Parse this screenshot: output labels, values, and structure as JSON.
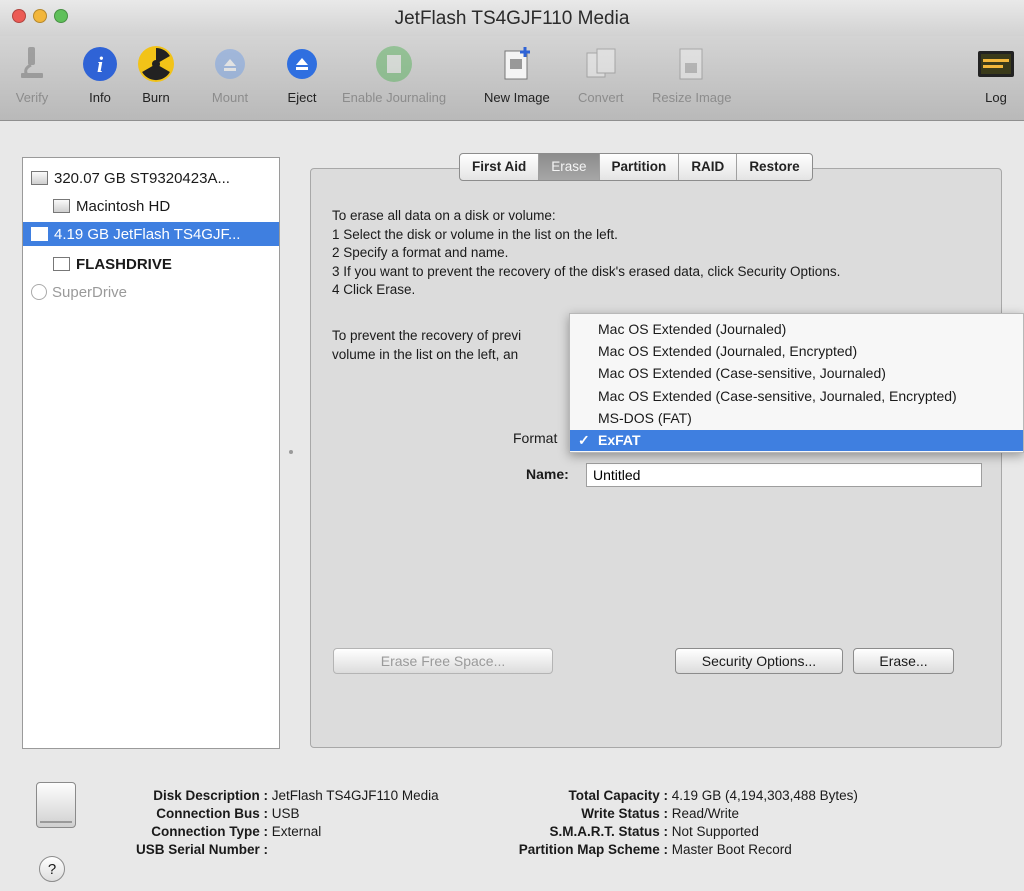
{
  "window": {
    "title": "JetFlash TS4GJF110 Media",
    "traffic_colors": [
      "#ec5b55",
      "#f2b63b",
      "#5fc05a"
    ]
  },
  "toolbar": {
    "items": [
      {
        "label": "Verify",
        "icon": "microscope-icon",
        "enabled": false
      },
      {
        "label": "Info",
        "icon": "info-icon",
        "enabled": true
      },
      {
        "label": "Burn",
        "icon": "radiation-icon",
        "enabled": true
      },
      {
        "label": "Mount",
        "icon": "mount-icon",
        "enabled": false
      },
      {
        "label": "Eject",
        "icon": "eject-icon",
        "enabled": true
      },
      {
        "label": "Enable Journaling",
        "icon": "journal-icon",
        "enabled": false
      },
      {
        "label": "New Image",
        "icon": "new-image-icon",
        "enabled": true
      },
      {
        "label": "Convert",
        "icon": "convert-icon",
        "enabled": false
      },
      {
        "label": "Resize Image",
        "icon": "resize-image-icon",
        "enabled": false
      },
      {
        "label": "Log",
        "icon": "log-icon",
        "enabled": true
      }
    ]
  },
  "sidebar": {
    "items": [
      {
        "label": "320.07 GB ST9320423A...",
        "level": 0,
        "selected": false,
        "dim": false
      },
      {
        "label": "Macintosh HD",
        "level": 1,
        "selected": false,
        "dim": false
      },
      {
        "label": "4.19 GB JetFlash TS4GJF...",
        "level": 0,
        "selected": true,
        "dim": false
      },
      {
        "label": "FLASHDRIVE",
        "level": 1,
        "selected": false,
        "dim": false
      },
      {
        "label": "SuperDrive",
        "level": 0,
        "selected": false,
        "dim": true
      }
    ]
  },
  "tabs": [
    {
      "label": "First Aid",
      "active": false
    },
    {
      "label": "Erase",
      "active": true
    },
    {
      "label": "Partition",
      "active": false
    },
    {
      "label": "RAID",
      "active": false
    },
    {
      "label": "Restore",
      "active": false
    }
  ],
  "erase": {
    "instructions": [
      "To erase all data on a disk or volume:",
      "1 Select the disk or volume in the list on the left.",
      "2 Specify a format and name.",
      "3 If you want to prevent the recovery of the disk's erased data, click Security Options.",
      "4 Click Erase."
    ],
    "prevent_text": [
      "To prevent the recovery of previ",
      "volume in the list on the left, an"
    ],
    "format_label": "Format",
    "name_label": "Name:",
    "name_value": "Untitled",
    "format_options": [
      {
        "label": "Mac OS Extended (Journaled)",
        "selected": false
      },
      {
        "label": "Mac OS Extended (Journaled, Encrypted)",
        "selected": false
      },
      {
        "label": "Mac OS Extended (Case-sensitive, Journaled)",
        "selected": false
      },
      {
        "label": "Mac OS Extended (Case-sensitive, Journaled, Encrypted)",
        "selected": false
      },
      {
        "label": "MS-DOS (FAT)",
        "selected": false
      },
      {
        "label": "ExFAT",
        "selected": true
      }
    ],
    "check_mark": "✓",
    "buttons": {
      "erase_free_space": "Erase Free Space...",
      "security_options": "Security Options...",
      "erase": "Erase..."
    }
  },
  "info": {
    "left": [
      {
        "key": "Disk Description :",
        "value": "JetFlash TS4GJF110 Media"
      },
      {
        "key": "Connection Bus :",
        "value": "USB"
      },
      {
        "key": "Connection Type :",
        "value": "External"
      },
      {
        "key": "USB Serial Number :",
        "value": ""
      }
    ],
    "right": [
      {
        "key": "Total Capacity :",
        "value": "4.19 GB (4,194,303,488 Bytes)"
      },
      {
        "key": "Write Status :",
        "value": "Read/Write"
      },
      {
        "key": "S.M.A.R.T. Status :",
        "value": "Not Supported"
      },
      {
        "key": "Partition Map Scheme :",
        "value": "Master Boot Record"
      }
    ],
    "help": "?"
  },
  "colors": {
    "selection": "#3f7fe0"
  }
}
